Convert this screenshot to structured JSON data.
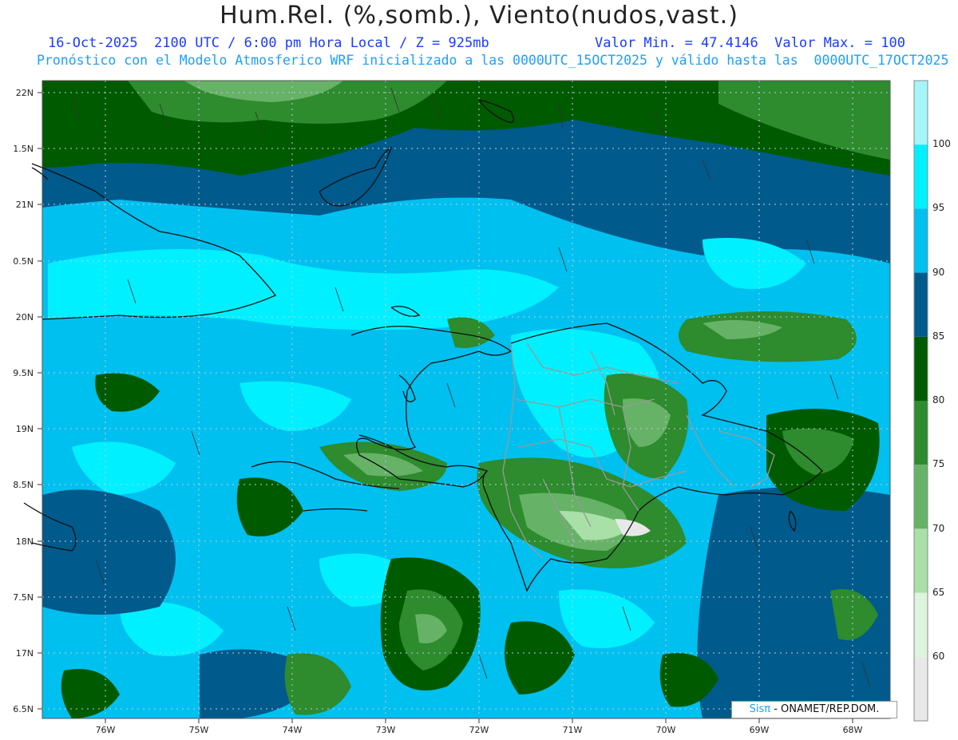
{
  "header": {
    "title": "Hum.Rel. (%,somb.), Viento(nudos,vast.)",
    "line1": "16-Oct-2025  2100 UTC / 6:00 pm Hora Local / Z = 925mb",
    "line1_right": "Valor Min. = 47.4146  Valor Max. = 100",
    "line2": "Pronóstico con el Modelo Atmosferico WRF inicializado a las 0000UTC_15OCT2025 y válido hasta las  0000UTC_17OCT2025"
  },
  "axes": {
    "lat_labels": [
      "22N",
      "1.5N",
      "21N",
      "0.5N",
      "20N",
      "9.5N",
      "19N",
      "8.5N",
      "18N",
      "7.5N",
      "17N",
      "6.5N"
    ],
    "lon_labels": [
      "76W",
      "75W",
      "74W",
      "73W",
      "72W",
      "71W",
      "70W",
      "69W",
      "68W"
    ]
  },
  "colorbar": {
    "labels": [
      "100",
      "95",
      "90",
      "85",
      "80",
      "75",
      "70",
      "65",
      "60"
    ],
    "colors": [
      "#a5f5fa",
      "#00f0ff",
      "#00c0f0",
      "#005a8c",
      "#005a00",
      "#2e8b2e",
      "#66b266",
      "#a8e0a8",
      "#dcf5dc",
      "#e8e8e8"
    ]
  },
  "credit": {
    "brand": "Sisπ",
    "text": "- ONAMET/REP.DOM."
  }
}
